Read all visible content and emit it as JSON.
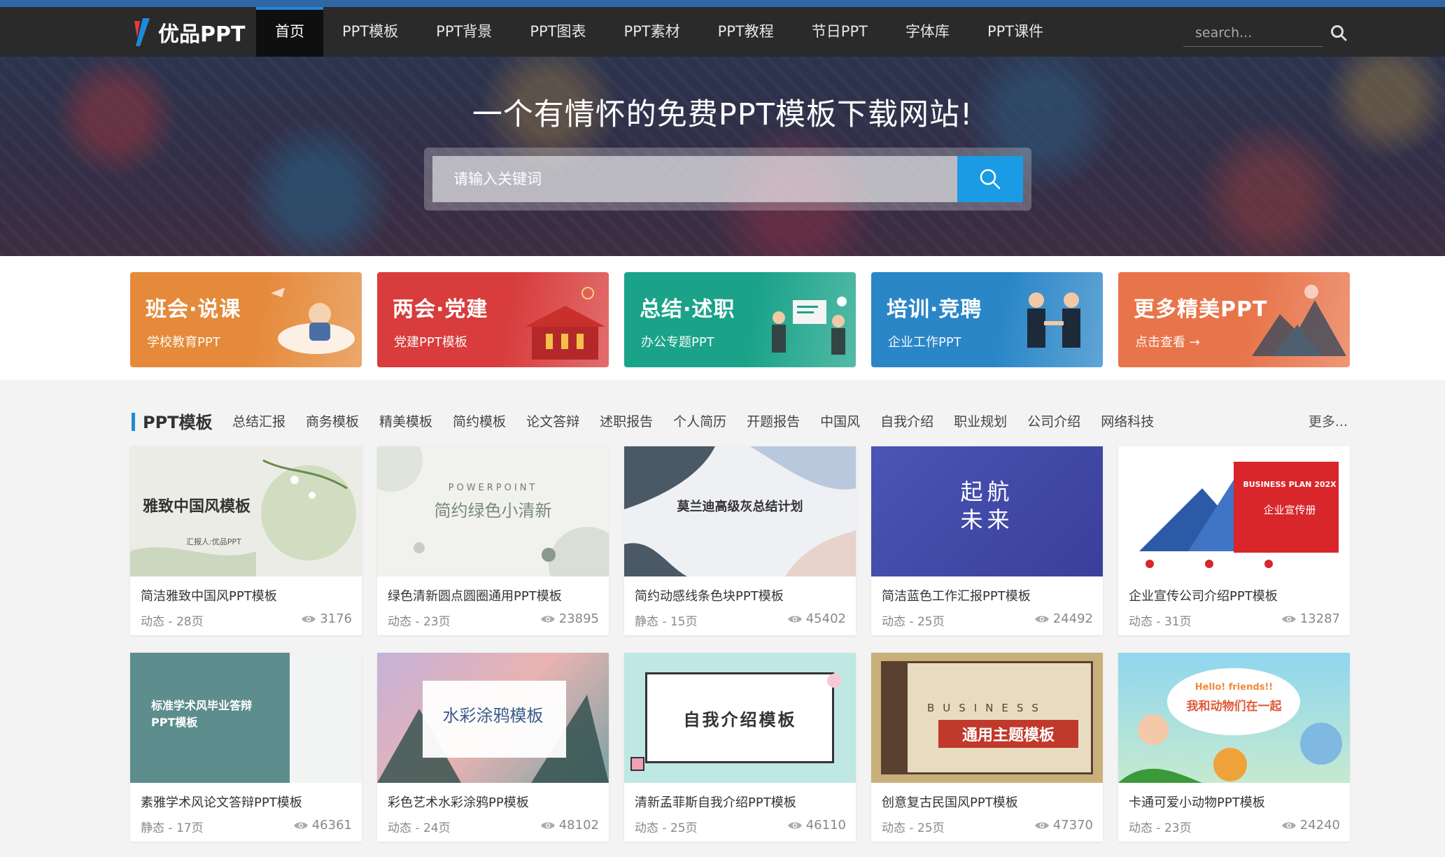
{
  "brand": {
    "logo_text": "优品PPT",
    "accent": "#1f8ad6"
  },
  "nav": {
    "items": [
      "首页",
      "PPT模板",
      "PPT背景",
      "PPT图表",
      "PPT素材",
      "PPT教程",
      "节日PPT",
      "字体库",
      "PPT课件"
    ],
    "active_index": 0,
    "search_placeholder": "search..."
  },
  "hero": {
    "title": "一个有情怀的免费PPT模板下载网站!",
    "search_placeholder": "请输入关键词"
  },
  "categories": [
    {
      "title": "班会·说课",
      "sub": "学校教育PPT",
      "color": "#e58a3a"
    },
    {
      "title": "两会·党建",
      "sub": "党建PPT模板",
      "color": "#d83c3c"
    },
    {
      "title": "总结·述职",
      "sub": "办公专题PPT",
      "color": "#1aa389"
    },
    {
      "title": "培训·竞聘",
      "sub": "企业工作PPT",
      "color": "#2a86c7"
    },
    {
      "title": "更多精美PPT",
      "sub": "点击查看 →",
      "color": "#e8744a"
    }
  ],
  "section": {
    "title": "PPT模板",
    "tabs": [
      "总结汇报",
      "商务模板",
      "精美模板",
      "简约模板",
      "论文答辩",
      "述职报告",
      "个人简历",
      "开题报告",
      "中国风",
      "自我介绍",
      "职业规划",
      "公司介绍",
      "网络科技"
    ],
    "more": "更多..."
  },
  "cards": [
    {
      "title": "简洁雅致中国风PPT模板",
      "meta": "动态 - 28页",
      "views": "3176",
      "thumb_text": "雅致中国风模板",
      "thumb_sub": "汇报人:优品PPT"
    },
    {
      "title": "绿色清新圆点圆圈通用PPT模板",
      "meta": "动态 - 23页",
      "views": "23895",
      "thumb_text": "简约绿色小清新",
      "thumb_sub": "POWERPOINT"
    },
    {
      "title": "简约动感线条色块PPT模板",
      "meta": "静态 - 15页",
      "views": "45402",
      "thumb_text": "莫兰迪高级灰总结计划",
      "thumb_sub": ""
    },
    {
      "title": "简洁蓝色工作汇报PPT模板",
      "meta": "动态 - 25页",
      "views": "24492",
      "thumb_text": "起航",
      "thumb_sub": "未来"
    },
    {
      "title": "企业宣传公司介绍PPT模板",
      "meta": "动态 - 31页",
      "views": "13287",
      "thumb_text": "企业宣传册",
      "thumb_sub": "BUSINESS PLAN 202X"
    },
    {
      "title": "素雅学术风论文答辩PPT模板",
      "meta": "静态 - 17页",
      "views": "46361",
      "thumb_text": "标准学术风毕业答辩",
      "thumb_sub": "PPT模板"
    },
    {
      "title": "彩色艺术水彩涂鸦PP模板",
      "meta": "动态 - 24页",
      "views": "48102",
      "thumb_text": "水彩涂鸦模板",
      "thumb_sub": ""
    },
    {
      "title": "清新孟菲斯自我介绍PPT模板",
      "meta": "动态 - 25页",
      "views": "46110",
      "thumb_text": "自我介绍模板",
      "thumb_sub": ""
    },
    {
      "title": "创意复古民国风PPT模板",
      "meta": "动态 - 25页",
      "views": "47370",
      "thumb_text": "通用主题模板",
      "thumb_sub": "BUSINESS"
    },
    {
      "title": "卡通可爱小动物PPT模板",
      "meta": "动态 - 23页",
      "views": "24240",
      "thumb_text": "我和动物们在一起",
      "thumb_sub": "Hello! friends!!"
    }
  ]
}
